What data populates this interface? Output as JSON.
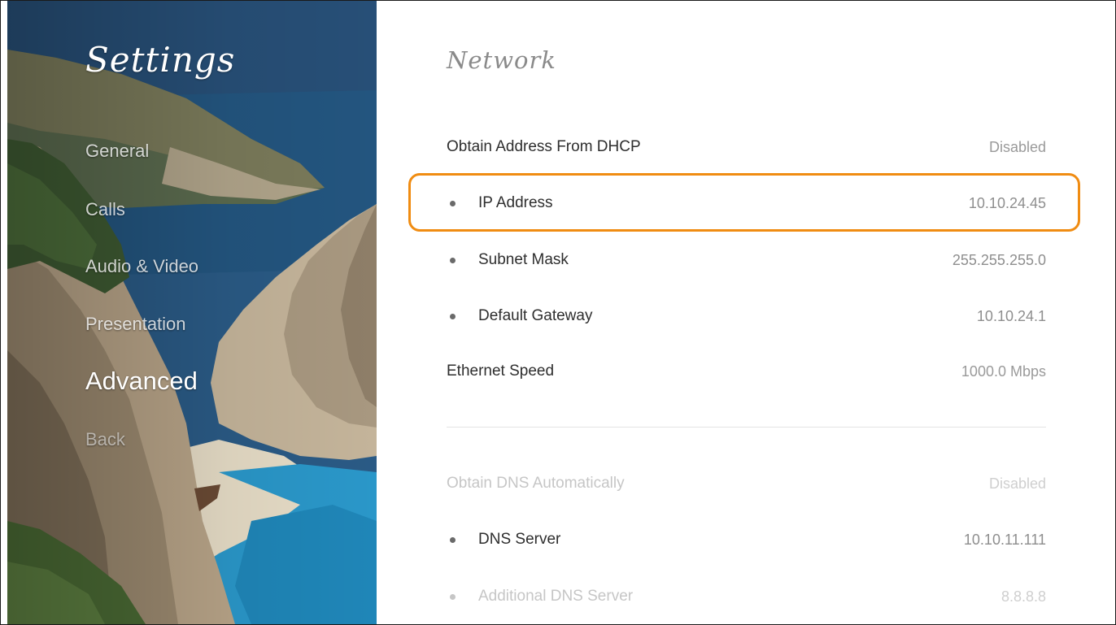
{
  "sidebar": {
    "title": "Settings",
    "items": [
      {
        "label": "General"
      },
      {
        "label": "Calls"
      },
      {
        "label": "Audio & Video"
      },
      {
        "label": "Presentation"
      },
      {
        "label": "Advanced"
      },
      {
        "label": "Back"
      }
    ],
    "active_item": "Advanced"
  },
  "main": {
    "section_title": "Network",
    "rows": [
      {
        "label": "Obtain Address From DHCP",
        "value": "Disabled",
        "bullet": false
      },
      {
        "label": "IP Address",
        "value": "10.10.24.45",
        "bullet": true,
        "focused": true
      },
      {
        "label": "Subnet Mask",
        "value": "255.255.255.0",
        "bullet": true
      },
      {
        "label": "Default Gateway",
        "value": "10.10.24.1",
        "bullet": true
      },
      {
        "label": "Ethernet Speed",
        "value": "1000.0 Mbps",
        "bullet": false
      },
      {
        "label": "Obtain DNS Automatically",
        "value": "Disabled",
        "bullet": false
      },
      {
        "label": "DNS Server",
        "value": "10.10.11.111",
        "bullet": true
      },
      {
        "label": "Additional DNS Server",
        "value": "8.8.8.8",
        "bullet": true
      }
    ]
  },
  "colors": {
    "focus_outline": "#f08c12",
    "text_primary": "#2e2e2e",
    "text_value": "#9a9a9a",
    "text_disabled": "#c6c6c6"
  }
}
